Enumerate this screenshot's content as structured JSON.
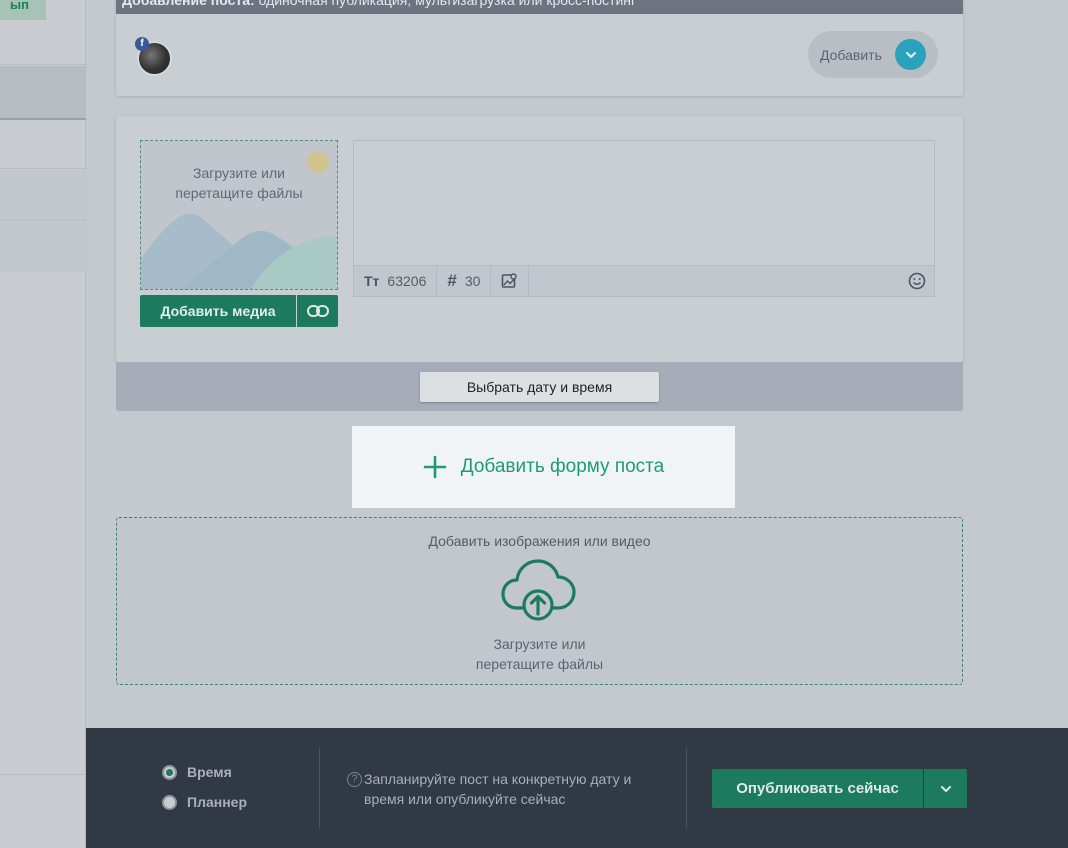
{
  "sidebar": {
    "badge_text": "ып"
  },
  "post_header": {
    "title_bold": "Добавление поста:",
    "title_rest": " одиночная публикация, мультизагрузка или кросс-постинг"
  },
  "account": {
    "network_badge": "f",
    "add_label": "Добавить"
  },
  "media": {
    "upload_line1": "Загрузите или",
    "upload_line2": "перетащите файлы",
    "add_media_label": "Добавить медиа"
  },
  "editor": {
    "text_value": "",
    "chars_left": "63206",
    "hashtags_left": "30"
  },
  "schedule": {
    "pick_datetime_label": "Выбрать дату и время"
  },
  "add_form": {
    "label": "Добавить форму поста"
  },
  "drop_zone": {
    "title": "Добавить изображения или видео",
    "line1": "Загрузите или",
    "line2": "перетащите файлы"
  },
  "footer": {
    "mode_options": [
      {
        "label": "Время",
        "selected": true
      },
      {
        "label": "Планнер",
        "selected": false
      }
    ],
    "hint_icon": "?",
    "hint": "Запланируйте пост на конкретную дату и время или опубликуйте сейчас",
    "publish_label": "Опубликовать сейчас"
  },
  "colors": {
    "accent_green": "#1c7b5c",
    "highlight_green_text": "#1f9b74",
    "footer_bg": "#303944",
    "add_circle": "#2ba2bd"
  }
}
